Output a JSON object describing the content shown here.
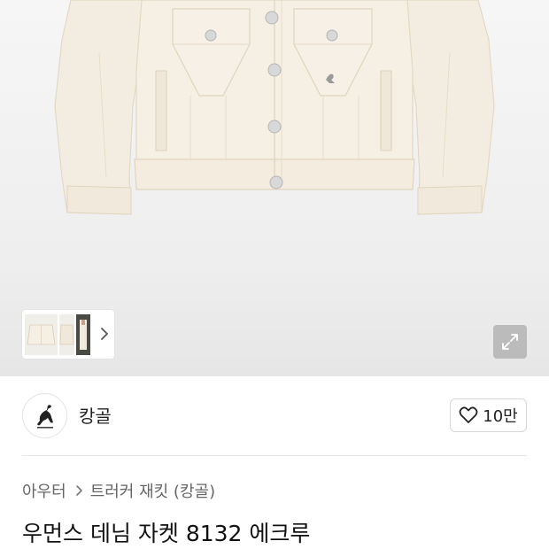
{
  "brand": {
    "name": "캉골",
    "logo_icon": "kangaroo-logo-icon"
  },
  "like": {
    "icon": "heart-outline-icon",
    "count": "10만"
  },
  "gallery": {
    "zoom_icon": "expand-icon",
    "next_icon": "chevron-right-icon"
  },
  "breadcrumb": {
    "category": "아우터",
    "subcategory": "트러커 재킷 (캉골)"
  },
  "product": {
    "title": "우먼스 데님 자켓 8132 에크루"
  },
  "colors": {
    "jacket": "#f3ede1",
    "stitch": "#e2d6bf",
    "background": "#f2f2f2"
  }
}
